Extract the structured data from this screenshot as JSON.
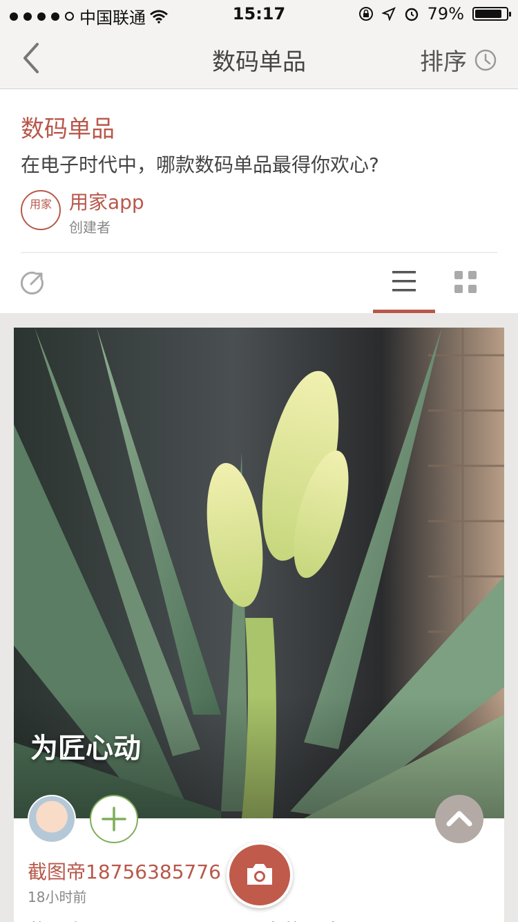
{
  "status_bar": {
    "carrier": "中国联通",
    "time": "15:17",
    "battery": "79%"
  },
  "nav": {
    "title": "数码单品",
    "sort_label": "排序"
  },
  "header": {
    "title": "数码单品",
    "description": "在电子时代中，哪款数码单品最得你欢心?",
    "creator_logo_text": "用家",
    "creator_name": "用家app",
    "creator_role": "创建者"
  },
  "post": {
    "caption": "为匠心动",
    "user_name": "截图帝18756385776",
    "time_ago": "18小时前",
    "preview_left": "截图帝",
    "preview_right": "分享的照片"
  },
  "colors": {
    "accent": "#b8574a",
    "add_green": "#7fad5a"
  }
}
